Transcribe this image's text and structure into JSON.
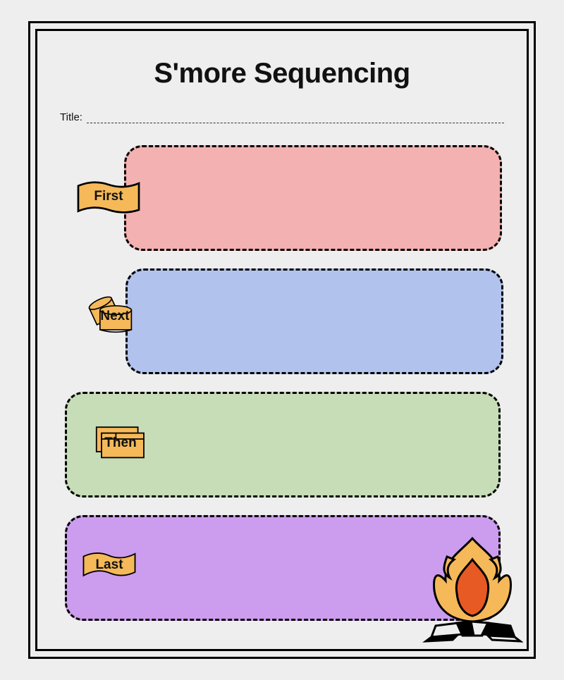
{
  "page_title": "S'more Sequencing",
  "title_label": "Title:",
  "steps": [
    {
      "label": "First",
      "color": "#f3b1b1"
    },
    {
      "label": "Next",
      "color": "#b1c2ec"
    },
    {
      "label": "Then",
      "color": "#c6ddb7"
    },
    {
      "label": "Last",
      "color": "#cc9dee"
    }
  ],
  "marker_fill": "#f5b95a",
  "fire_colors": {
    "outer": "#f5b95a",
    "inner": "#e75a24"
  }
}
